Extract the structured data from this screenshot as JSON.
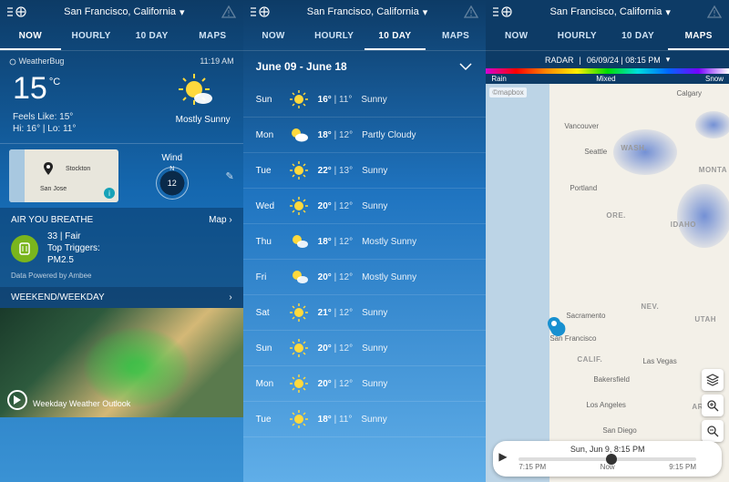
{
  "location": "San Francisco, California",
  "tabs": {
    "now": "NOW",
    "hourly": "HOURLY",
    "tenday": "10 DAY",
    "maps": "MAPS"
  },
  "panelA": {
    "brand": "WeatherBug",
    "time": "11:19 AM",
    "temp": "15",
    "unit": "°C",
    "feels": "Feels Like: 15°",
    "hilo": "Hi: 16° | Lo: 11°",
    "condition": "Mostly Sunny",
    "wind_label": "Wind",
    "wind_speed": "12",
    "map_cities": {
      "stockton": "Stockton",
      "sanjose": "San Jose"
    },
    "air": {
      "title": "AIR YOU BREATHE",
      "maplink": "Map",
      "value": "33 | Fair",
      "triggers_label": "Top Triggers:",
      "triggers": "PM2.5",
      "foot": "Data Powered by Ambee"
    },
    "weekend": {
      "title": "WEEKEND/WEEKDAY",
      "caption": "Weekday Weather Outlook"
    }
  },
  "panelB": {
    "range": "June 09 - June 18",
    "days": [
      {
        "name": "Sun",
        "icon": "sun",
        "hi": "16°",
        "lo": "11°",
        "desc": "Sunny"
      },
      {
        "name": "Mon",
        "icon": "partly",
        "hi": "18°",
        "lo": "12°",
        "desc": "Partly Cloudy"
      },
      {
        "name": "Tue",
        "icon": "sun",
        "hi": "22°",
        "lo": "13°",
        "desc": "Sunny"
      },
      {
        "name": "Wed",
        "icon": "sun",
        "hi": "20°",
        "lo": "12°",
        "desc": "Sunny"
      },
      {
        "name": "Thu",
        "icon": "mostly",
        "hi": "18°",
        "lo": "12°",
        "desc": "Mostly Sunny"
      },
      {
        "name": "Fri",
        "icon": "mostly",
        "hi": "20°",
        "lo": "12°",
        "desc": "Mostly Sunny"
      },
      {
        "name": "Sat",
        "icon": "sun",
        "hi": "21°",
        "lo": "12°",
        "desc": "Sunny"
      },
      {
        "name": "Sun",
        "icon": "sun",
        "hi": "20°",
        "lo": "12°",
        "desc": "Sunny"
      },
      {
        "name": "Mon",
        "icon": "sun",
        "hi": "20°",
        "lo": "12°",
        "desc": "Sunny"
      },
      {
        "name": "Tue",
        "icon": "sun",
        "hi": "18°",
        "lo": "11°",
        "desc": "Sunny"
      }
    ]
  },
  "panelC": {
    "radar_label": "RADAR",
    "radar_ts": "06/09/24 | 08:15 PM",
    "spectrum": {
      "rain": "Rain",
      "mixed": "Mixed",
      "snow": "Snow"
    },
    "mapbox": "©mapbox",
    "cities": {
      "calgary": "Calgary",
      "vancouver": "Vancouver",
      "seattle": "Seattle",
      "portland": "Portland",
      "sacramento": "Sacramento",
      "sanfrancisco": "San Francisco",
      "bakersfield": "Bakersfield",
      "losangeles": "Los Angeles",
      "sandiego": "San Diego",
      "lasvegas": "Las Vegas"
    },
    "states": {
      "wash": "WASH.",
      "ore": "ORE.",
      "idaho": "IDAHO",
      "monta": "MONTA",
      "nev": "NEV.",
      "utah": "UTAH",
      "calif": "CALIF.",
      "ariz": "ARIZ"
    },
    "timeline": {
      "date": "Sun, Jun 9, 8:15 PM",
      "start": "7:15 PM",
      "now": "Now",
      "end": "9:15 PM"
    }
  }
}
